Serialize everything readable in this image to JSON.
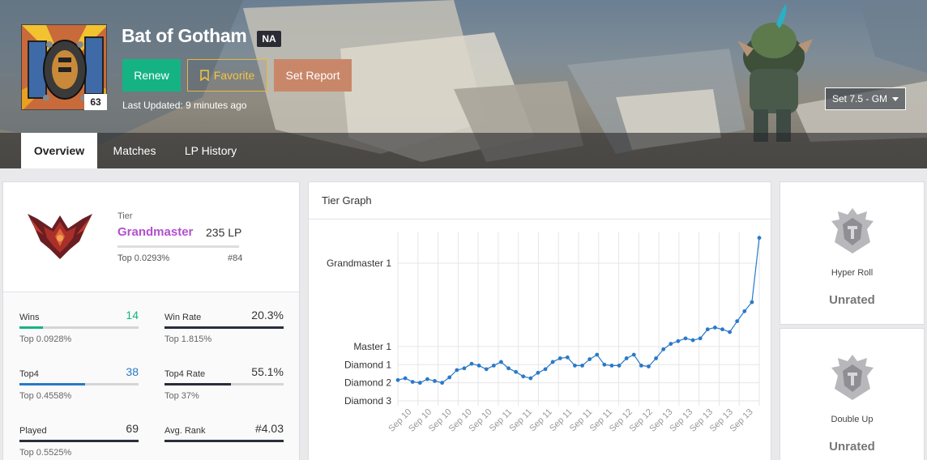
{
  "profile": {
    "name": "Bat of Gotham",
    "region": "NA",
    "level": "63",
    "last_updated": "Last Updated: 9 minutes ago",
    "set_select": "Set 7.5 - GM"
  },
  "actions": {
    "renew": "Renew",
    "favorite": "Favorite",
    "report": "Set Report"
  },
  "tabs": [
    "Overview",
    "Matches",
    "LP History"
  ],
  "rank": {
    "tier_label": "Tier",
    "tier_name": "Grandmaster",
    "lp": "235 LP",
    "top": "Top 0.0293%",
    "ladder_rank": "#84",
    "tier_color": "#b34fcf"
  },
  "stats": [
    {
      "label": "Wins",
      "value": "14",
      "sub": "Top 0.0928%",
      "fill": 0.2,
      "color": "#15b383",
      "value_color": "#15b383"
    },
    {
      "label": "Win Rate",
      "value": "20.3%",
      "sub": "Top 1.815%",
      "fill": 1.0,
      "color": "#2a2d3c",
      "value_color": "#333333"
    },
    {
      "label": "Top4",
      "value": "38",
      "sub": "Top 0.4558%",
      "fill": 0.55,
      "color": "#2a79c7",
      "value_color": "#2a79c7"
    },
    {
      "label": "Top4 Rate",
      "value": "55.1%",
      "sub": "Top 37%",
      "fill": 0.56,
      "color": "#2a2d3c",
      "value_color": "#333333"
    },
    {
      "label": "Played",
      "value": "69",
      "sub": "Top 0.5525%",
      "fill": 1.0,
      "color": "#2a2d3c",
      "value_color": "#333333"
    },
    {
      "label": "Avg. Rank",
      "value": "#4.03",
      "sub": "",
      "fill": 1.0,
      "color": "#2a2d3c",
      "value_color": "#333333"
    }
  ],
  "graph": {
    "title": "Tier Graph"
  },
  "chart_data": {
    "type": "line",
    "title": "Tier Graph",
    "y_tick_labels": [
      "Diamond 3",
      "Diamond 2",
      "Diamond 1",
      "Master 1",
      "Grandmaster 1"
    ],
    "y_tick_values": [
      0,
      1,
      2,
      3,
      7.6
    ],
    "x_tick_labels": [
      "Sep 10",
      "Sep 10",
      "Sep 10",
      "Sep 10",
      "Sep 10",
      "Sep 11",
      "Sep 11",
      "Sep 11",
      "Sep 11",
      "Sep 11",
      "Sep 11",
      "Sep 12",
      "Sep 12",
      "Sep 13",
      "Sep 13",
      "Sep 13",
      "Sep 13",
      "Sep 13"
    ],
    "values": [
      1.15,
      1.25,
      1.05,
      1.0,
      1.2,
      1.1,
      1.0,
      1.3,
      1.7,
      1.8,
      2.05,
      1.95,
      1.75,
      1.95,
      2.15,
      1.8,
      1.6,
      1.35,
      1.25,
      1.55,
      1.75,
      2.15,
      2.35,
      2.4,
      1.95,
      1.95,
      2.3,
      2.55,
      2.0,
      1.95,
      1.95,
      2.35,
      2.55,
      1.95,
      1.9,
      2.35,
      2.85,
      3.15,
      3.3,
      3.45,
      3.35,
      3.45,
      3.95,
      4.05,
      3.95,
      3.8,
      4.4,
      4.95,
      5.45,
      9.0
    ],
    "color": "#2a79c7",
    "grid": true
  },
  "modes": [
    {
      "name": "Hyper Roll",
      "status": "Unrated",
      "icon": "shield-emblem-icon"
    },
    {
      "name": "Double Up",
      "status": "Unrated",
      "icon": "shield-emblem-icon"
    }
  ]
}
